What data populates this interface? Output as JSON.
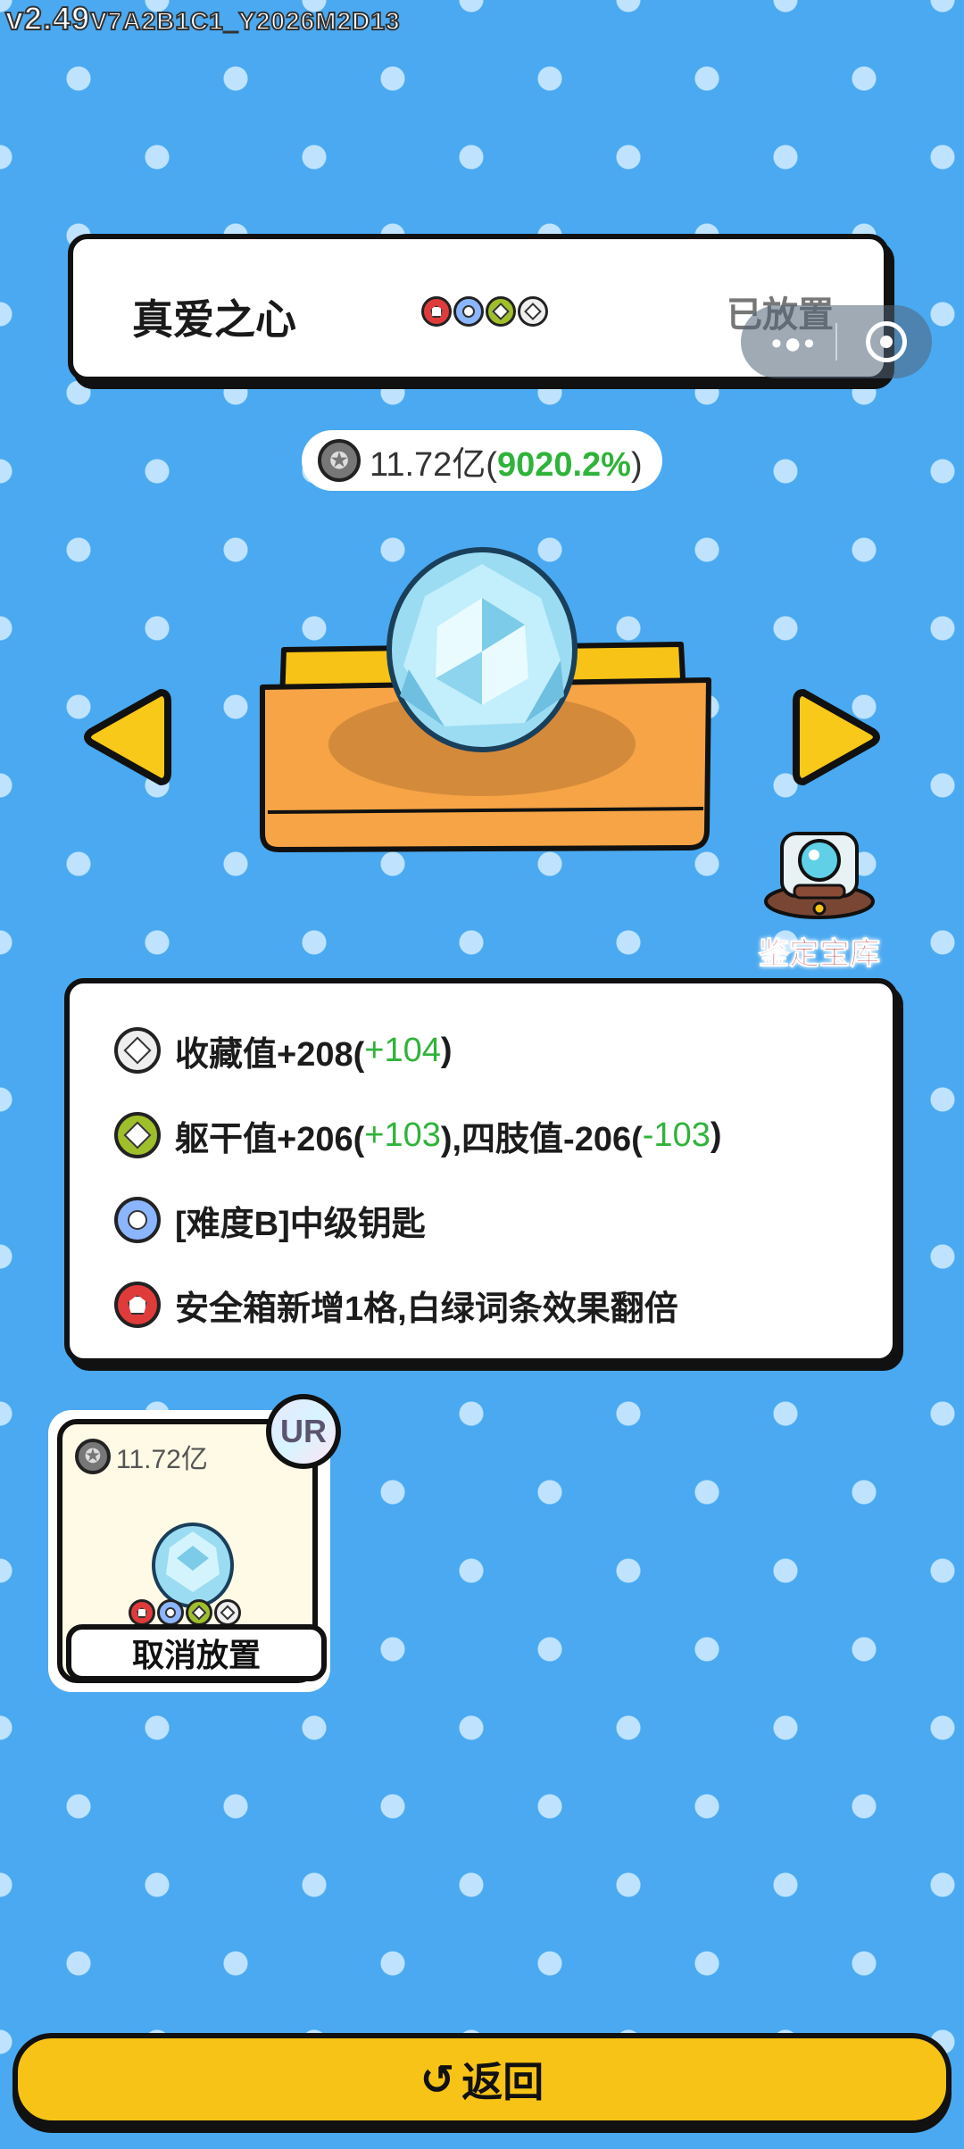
{
  "version": {
    "main": "v2.49",
    "sub": "V7A2B1C1_Y2026M2D13"
  },
  "item": {
    "name": "真爱之心",
    "status": "已放置",
    "value_text": "11.72亿(",
    "value_pct": "9020.2%",
    "value_close": ")"
  },
  "appraise": {
    "label": "鉴定宝库"
  },
  "effects": [
    {
      "gem": "white-diamond-gem-icon",
      "parts": [
        "收藏值+208(",
        "+104",
        ")"
      ]
    },
    {
      "gem": "green-diamond-gem-icon",
      "parts": [
        "躯干值+206(",
        "+103",
        "),四肢值-206(",
        "-103",
        ")"
      ]
    },
    {
      "gem": "blue-circle-gem-icon",
      "text": "[难度B]中级钥匙"
    },
    {
      "gem": "red-pentagon-gem-icon",
      "text": "安全箱新增1格,白绿词条效果翻倍"
    }
  ],
  "card": {
    "value": "11.72亿",
    "rarity": "UR",
    "button_label": "取消放置"
  },
  "footer": {
    "return_icon": "↺",
    "return_label": "返回"
  },
  "colors": {
    "background": "#4aa9f0",
    "accent_yellow": "#f6c316",
    "bonus_green": "#2fb33a"
  }
}
